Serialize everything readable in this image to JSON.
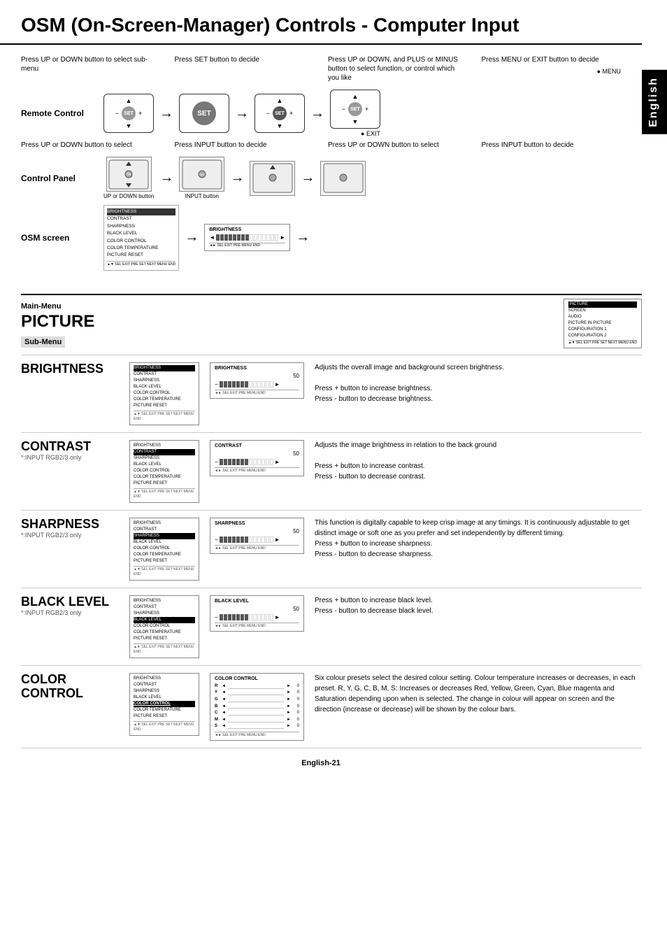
{
  "page": {
    "title": "OSM (On-Screen-Manager) Controls - Computer Input",
    "side_tab": "English",
    "page_number": "English-21"
  },
  "instructions": {
    "step1": "Press UP or DOWN button to select sub-menu",
    "step2": "Press SET button to decide",
    "step3": "Press UP or DOWN, and PLUS or MINUS button to select function, or control which you like",
    "step4": "Press MENU or EXIT button to decide",
    "step1b": "Press UP or DOWN button to select",
    "step2b": "Press INPUT button to decide",
    "step3b": "Press UP or DOWN button to select",
    "step4b": "Press INPUT button to decide"
  },
  "section_labels": {
    "remote_control": "Remote Control",
    "control_panel": "Control Panel",
    "osm_screen": "OSM screen",
    "main_menu": "Main-Menu",
    "sub_menu": "Sub-Menu",
    "picture": "PICTURE",
    "menu_label": "● MENU",
    "exit_label": "● EXIT",
    "up_down_button": "UP or DOWN button",
    "input_button": "INPUT button"
  },
  "main_menu_box": {
    "items": [
      "PICTURE",
      "SCREEN",
      "AUDIO",
      "PICTURE IN PICTURE",
      "CONFIGURATION 1",
      "CONFIGURATION 2"
    ]
  },
  "submenu_items": [
    {
      "id": "brightness",
      "title": "BRIGHTNESS",
      "subtitle": "",
      "menu_highlight": "BRIGHTNESS",
      "menu_items": [
        "BRIGHTNESS",
        "CONTRAST",
        "SHARPNESS",
        "BLACK LEVEL",
        "COLOR CONTROL",
        "COLOR TEMPERATURE",
        "PICTURE RESET"
      ],
      "display_title": "BRIGHTNESS",
      "display_value": "50",
      "description": "Adjusts the overall image and background screen brightness.\n\nPress + button to increase brightness.\nPress - button to decrease brightness."
    },
    {
      "id": "contrast",
      "title": "CONTRAST",
      "subtitle": "*:INPUT RGB2/3 only",
      "menu_highlight": "CONTRAST",
      "menu_items": [
        "BRIGHTNESS",
        "CONTRAST",
        "SHARPNESS",
        "BLACK LEVEL",
        "COLOR CONTROL",
        "COLOR TEMPERATURE",
        "PICTURE RESET"
      ],
      "display_title": "CONTRAST",
      "display_value": "50",
      "description": "Adjusts the image brightness in relation to the back ground\n\nPress + button to increase contrast.\nPress - button to decrease contrast."
    },
    {
      "id": "sharpness",
      "title": "SHARPNESS",
      "subtitle": "*:INPUT RGB2/3 only",
      "menu_highlight": "SHARPNESS",
      "menu_items": [
        "BRIGHTNESS",
        "CONTRAST",
        "SHARPNESS",
        "BLACK LEVEL",
        "COLOR CONTROL",
        "COLOR TEMPERATURE",
        "PICTURE RESET"
      ],
      "display_title": "SHARPNESS",
      "display_value": "50",
      "description": "This function is digitally capable to keep crisp image at any timings. It is continuously adjustable to get distinct image or soft one as you prefer and set independently by different timing.\nPress + button to increase sharpness.\nPress - button to decrease sharpness."
    },
    {
      "id": "black-level",
      "title": "BLACK LEVEL",
      "subtitle": "*:INPUT RGB2/3 only",
      "menu_highlight": "BLACK LEVEL",
      "menu_items": [
        "BRIGHTNESS",
        "CONTRAST",
        "SHARPNESS",
        "BLACK LEVEL",
        "COLOR CONTROL",
        "COLOR TEMPERATURE",
        "PICTURE RESET"
      ],
      "display_title": "BLACK LEVEL",
      "display_value": "50",
      "description": "Press + button to increase black level.\nPress - button to decrease black level."
    },
    {
      "id": "color-control",
      "title": "COLOR CONTROL",
      "subtitle": "",
      "menu_highlight": "COLOR CONTROL",
      "menu_items": [
        "BRIGHTNESS",
        "CONTRAST",
        "SHARPNESS",
        "BLACK LEVEL",
        "COLOR CONTROL",
        "COLOR TEMPERATURE",
        "PICTURE RESET"
      ],
      "display_title": "COLOR CONTROL",
      "color_rows": [
        {
          "label": "R",
          "value": "0"
        },
        {
          "label": "Y",
          "value": "0"
        },
        {
          "label": "G",
          "value": "0"
        },
        {
          "label": "B",
          "value": "0"
        },
        {
          "label": "C",
          "value": "0"
        },
        {
          "label": "M",
          "value": "0"
        },
        {
          "label": "S",
          "value": "0"
        }
      ],
      "description": "Six colour presets select the desired colour setting. Colour temperature increases or decreases, in each preset. R, Y, G, C, B, M, S: Increases or decreases Red, Yellow, Green, Cyan, Blue magenta and Saturation depending upon when is selected. The change in colour will appear on screen and the direction (increase or decrease) will be shown by the colour bars."
    }
  ],
  "nav_bar": "◄► SEL  EXIT PRE  MENU END"
}
